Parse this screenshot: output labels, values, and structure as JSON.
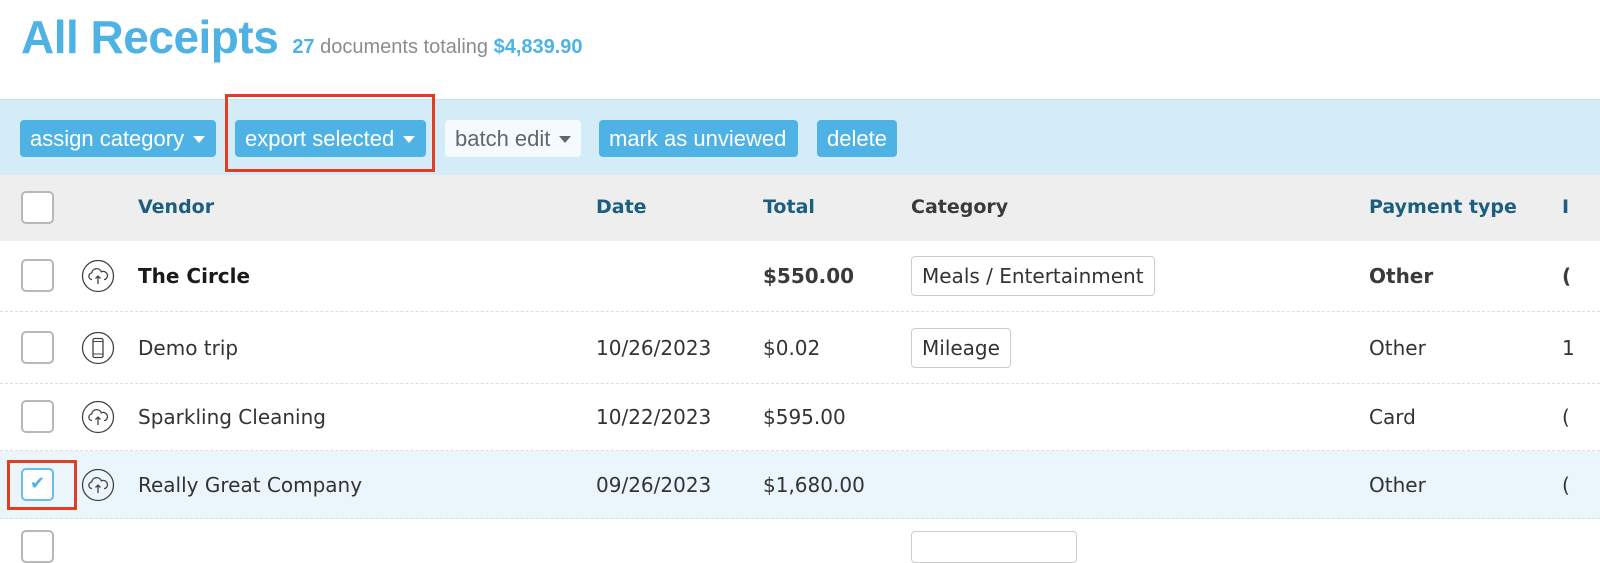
{
  "header": {
    "title": "All Receipts",
    "count": "27",
    "summary_text": "documents totaling",
    "total": "$4,839.90"
  },
  "toolbar": {
    "assign_category": "assign category",
    "export_selected": "export selected",
    "batch_edit": "batch edit",
    "mark_unviewed": "mark as unviewed",
    "delete": "delete"
  },
  "colors": {
    "accent": "#4eb3e4",
    "toolbar_bg": "#d4ecf8",
    "header_link": "#1c5e7e",
    "highlight_box": "#e03d22",
    "selected_row": "#eaf6fb"
  },
  "table": {
    "columns": {
      "vendor": "Vendor",
      "date": "Date",
      "total": "Total",
      "category": "Category",
      "payment_type": "Payment type",
      "next_partial": "I"
    },
    "rows": [
      {
        "checked": false,
        "source_icon": "cloud-upload-icon",
        "vendor": "The Circle",
        "date": "",
        "total": "$550.00",
        "category": "Meals / Entertainment",
        "payment_type": "Other",
        "next_partial": "(",
        "bold": true
      },
      {
        "checked": false,
        "source_icon": "mobile-phone-icon",
        "vendor": "Demo trip",
        "date": "10/26/2023",
        "total": "$0.02",
        "category": "Mileage",
        "payment_type": "Other",
        "next_partial": "1",
        "bold": false
      },
      {
        "checked": false,
        "source_icon": "cloud-upload-icon",
        "vendor": "Sparkling Cleaning",
        "date": "10/22/2023",
        "total": "$595.00",
        "category": "",
        "payment_type": "Card",
        "next_partial": "(",
        "bold": false
      },
      {
        "checked": true,
        "source_icon": "cloud-upload-icon",
        "vendor": "Really Great Company",
        "date": "09/26/2023",
        "total": "$1,680.00",
        "category": "",
        "payment_type": "Other",
        "next_partial": "(",
        "bold": false
      }
    ]
  }
}
